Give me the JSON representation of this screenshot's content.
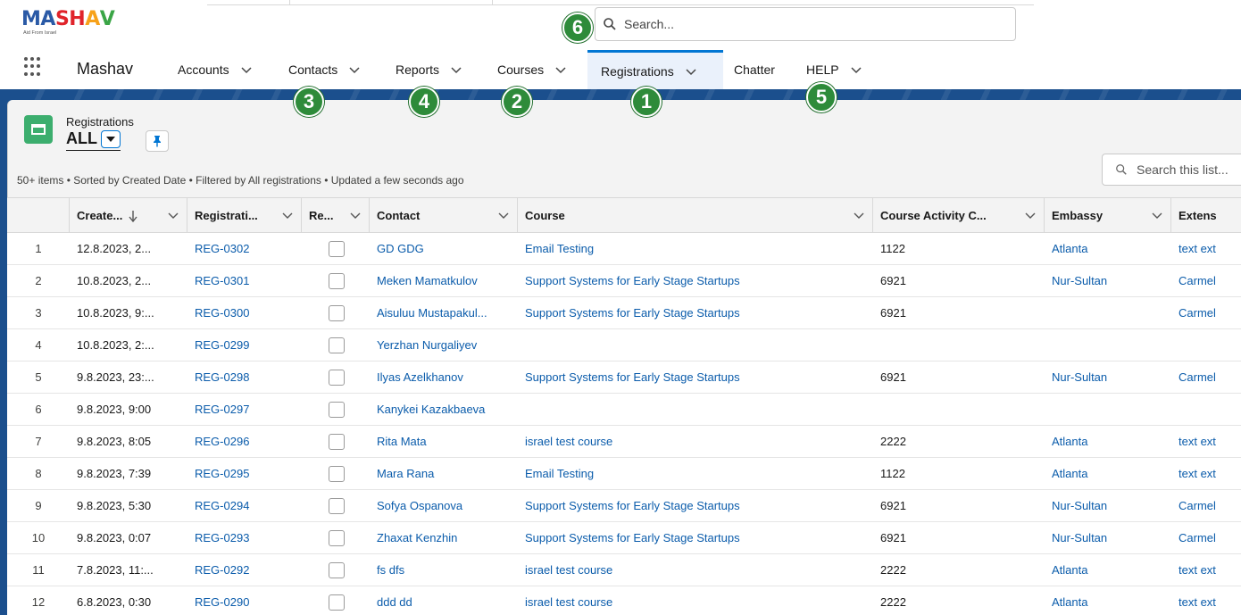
{
  "logo": {
    "text_letters": [
      "M",
      "A",
      "S",
      "H",
      "A",
      "V"
    ],
    "letter_colors": [
      "#2b5aa6",
      "#2b5aa6",
      "#e0242b",
      "#e0242b",
      "#f7a21b",
      "#3aa546"
    ],
    "tagline": "Aid From Israel"
  },
  "global_search": {
    "placeholder": "Search..."
  },
  "app": {
    "name": "Mashav"
  },
  "nav": [
    {
      "label": "Accounts",
      "has_menu": true
    },
    {
      "label": "Contacts",
      "has_menu": true
    },
    {
      "label": "Reports",
      "has_menu": true
    },
    {
      "label": "Courses",
      "has_menu": true
    },
    {
      "label": "Registrations",
      "has_menu": true,
      "active": true
    },
    {
      "label": "Chatter",
      "has_menu": false
    },
    {
      "label": "HELP",
      "has_menu": true
    }
  ],
  "badges": [
    "6",
    "3",
    "4",
    "2",
    "1",
    "5"
  ],
  "list_view": {
    "object_label": "Registrations",
    "view_name": "ALL",
    "status": "50+ items • Sorted by Created Date • Filtered by All registrations • Updated a few seconds ago",
    "search_placeholder": "Search this list..."
  },
  "colors": {
    "accent": "#0176d3",
    "link": "#0b5cab",
    "badge": "#2e8b3a",
    "object_icon": "#3cae6e",
    "banner": "#1b4f8d"
  },
  "table": {
    "columns": [
      "Create...",
      "Registrati...",
      "Re...",
      "Contact",
      "Course",
      "Course Activity C...",
      "Embassy",
      "Extens"
    ],
    "rows": [
      {
        "n": "1",
        "created": "12.8.2023, 2...",
        "reg": "REG-0302",
        "contact": "GD GDG",
        "course": "Email Testing",
        "activity": "1122",
        "embassy": "Atlanta",
        "ext": "text ext"
      },
      {
        "n": "2",
        "created": "10.8.2023, 2...",
        "reg": "REG-0301",
        "contact": "Meken Mamatkulov",
        "course": "Support Systems for Early Stage Startups",
        "activity": "6921",
        "embassy": "Nur-Sultan",
        "ext": "Carmel"
      },
      {
        "n": "3",
        "created": "10.8.2023, 9:...",
        "reg": "REG-0300",
        "contact": "Aisuluu Mustapakul...",
        "course": "Support Systems for Early Stage Startups",
        "activity": "6921",
        "embassy": "",
        "ext": "Carmel"
      },
      {
        "n": "4",
        "created": "10.8.2023, 2:...",
        "reg": "REG-0299",
        "contact": "Yerzhan Nurgaliyev",
        "course": "",
        "activity": "",
        "embassy": "",
        "ext": ""
      },
      {
        "n": "5",
        "created": "9.8.2023, 23:...",
        "reg": "REG-0298",
        "contact": "Ilyas Azelkhanov",
        "course": "Support Systems for Early Stage Startups",
        "activity": "6921",
        "embassy": "Nur-Sultan",
        "ext": "Carmel"
      },
      {
        "n": "6",
        "created": "9.8.2023, 9:00",
        "reg": "REG-0297",
        "contact": "Kanykei Kazakbaeva",
        "course": "",
        "activity": "",
        "embassy": "",
        "ext": ""
      },
      {
        "n": "7",
        "created": "9.8.2023, 8:05",
        "reg": "REG-0296",
        "contact": "Rita Mata",
        "course": "israel test course",
        "activity": "2222",
        "embassy": "Atlanta",
        "ext": "text ext"
      },
      {
        "n": "8",
        "created": "9.8.2023, 7:39",
        "reg": "REG-0295",
        "contact": "Mara Rana",
        "course": "Email Testing",
        "activity": "1122",
        "embassy": "Atlanta",
        "ext": "text ext"
      },
      {
        "n": "9",
        "created": "9.8.2023, 5:30",
        "reg": "REG-0294",
        "contact": "Sofya Ospanova",
        "course": "Support Systems for Early Stage Startups",
        "activity": "6921",
        "embassy": "Nur-Sultan",
        "ext": "Carmel"
      },
      {
        "n": "10",
        "created": "9.8.2023, 0:07",
        "reg": "REG-0293",
        "contact": "Zhaxat Kenzhin",
        "course": "Support Systems for Early Stage Startups",
        "activity": "6921",
        "embassy": "Nur-Sultan",
        "ext": "Carmel"
      },
      {
        "n": "11",
        "created": "7.8.2023, 11:...",
        "reg": "REG-0292",
        "contact": "fs dfs",
        "course": "israel test course",
        "activity": "2222",
        "embassy": "Atlanta",
        "ext": "text ext"
      },
      {
        "n": "12",
        "created": "6.8.2023, 0:30",
        "reg": "REG-0290",
        "contact": "ddd dd",
        "course": "israel test course",
        "activity": "2222",
        "embassy": "Atlanta",
        "ext": "text ext"
      }
    ]
  }
}
